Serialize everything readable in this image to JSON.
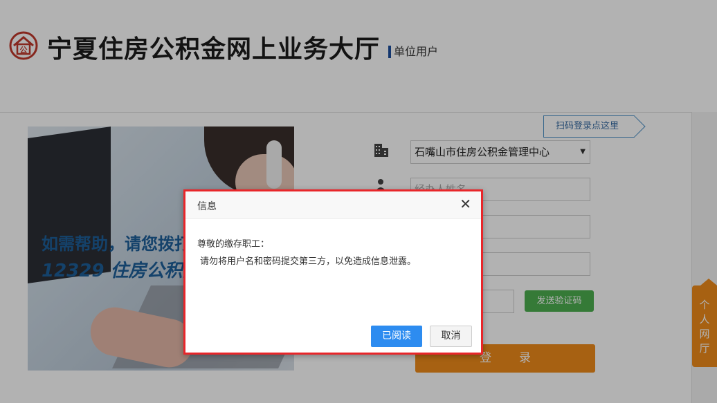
{
  "header": {
    "site_title": "宁夏住房公积金网上业务大厅",
    "user_type": "单位用户",
    "logo_icon": "housing-fund-logo-icon",
    "logo_text": "公"
  },
  "banner": {
    "line1": "如需帮助，请您拨打",
    "line2": "12329 住房公积金热线"
  },
  "qr_login": {
    "label": "扫码登录点这里"
  },
  "form": {
    "center_icon": "building-icon",
    "center_selected": "石嘴山市住房公积金管理中心",
    "user_icon": "person-icon",
    "name_placeholder": "经办人姓名",
    "send_code_label": "发送验证码",
    "login_label": "登录"
  },
  "side_tab": {
    "label_lines": [
      "个",
      "人",
      "网",
      "厅"
    ]
  },
  "dialog": {
    "title": "信息",
    "close_glyph": "✕",
    "greeting": "尊敬的缴存职工：",
    "message": "请勿将用户名和密码提交第三方，以免造成信息泄露。",
    "confirm_label": "已阅读",
    "cancel_label": "取消"
  },
  "colors": {
    "accent_blue": "#2d8cf0",
    "orange": "#f08c1a",
    "green": "#4caf50",
    "dialog_border": "#e8262a",
    "brand_red": "#c0392b"
  }
}
